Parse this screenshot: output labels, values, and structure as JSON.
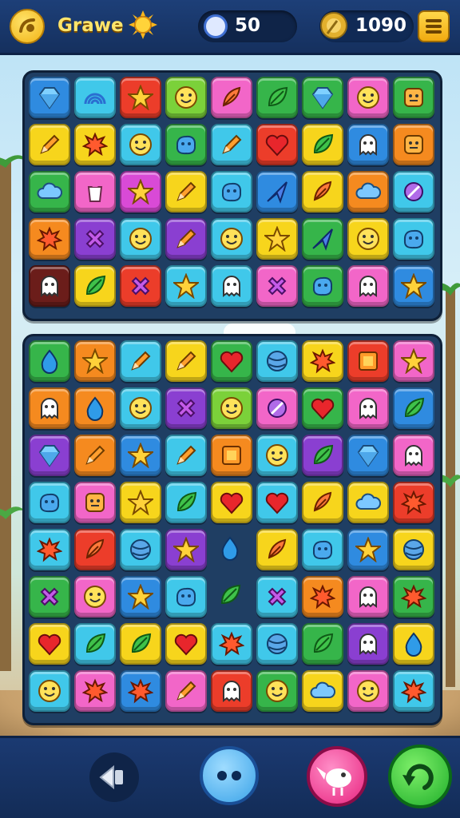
{
  "header": {
    "game_label": "Grawe",
    "moves_value": "50",
    "coins_value": "1090"
  },
  "colors": {
    "orange": "#f58a1f",
    "cyan": "#40c8ea",
    "red": "#ec3d2a",
    "lime": "#7bd13a",
    "pink": "#f266c8",
    "green": "#36b54a",
    "yellow": "#f7d51c",
    "purple": "#8a3fd1",
    "blue": "#2f8be0",
    "magenta": "#d94ad6",
    "teal": "#29b7c9",
    "maroon": "#6b1d1a"
  },
  "board_top": {
    "rows": [
      [
        [
          "blue",
          "gem-icon"
        ],
        [
          "cyan",
          "rainbow-icon"
        ],
        [
          "red",
          "star-icon"
        ],
        [
          "lime",
          "smile-icon"
        ],
        [
          "pink",
          "feather-icon"
        ],
        [
          "green",
          "leaf-icon"
        ],
        [
          "green",
          "gem-icon"
        ],
        [
          "pink",
          "smile-icon"
        ],
        [
          "green",
          "face-icon"
        ]
      ],
      [
        [
          "yellow",
          "pencil-icon"
        ],
        [
          "yellow",
          "splat-icon"
        ],
        [
          "cyan",
          "smile-icon"
        ],
        [
          "green",
          "blob-icon"
        ],
        [
          "cyan",
          "pencil-icon"
        ],
        [
          "red",
          "heart-icon"
        ],
        [
          "yellow",
          "leaf-icon"
        ],
        [
          "blue",
          "ghost-icon"
        ],
        [
          "orange",
          "face-icon"
        ]
      ],
      [
        [
          "green",
          "cloud-icon"
        ],
        [
          "pink",
          "cup-icon"
        ],
        [
          "magenta",
          "star-icon"
        ],
        [
          "yellow",
          "pencil-icon"
        ],
        [
          "cyan",
          "blob-icon"
        ],
        [
          "blue",
          "arrow-icon"
        ],
        [
          "yellow",
          "feather-icon"
        ],
        [
          "orange",
          "cloud-icon"
        ],
        [
          "cyan",
          "ribbon-icon"
        ]
      ],
      [
        [
          "orange",
          "splat-icon"
        ],
        [
          "purple",
          "cross-icon"
        ],
        [
          "cyan",
          "smile-icon"
        ],
        [
          "purple",
          "pencil-icon"
        ],
        [
          "cyan",
          "smile-icon"
        ],
        [
          "yellow",
          "star-icon"
        ],
        [
          "green",
          "arrow-icon"
        ],
        [
          "yellow",
          "smile-icon"
        ],
        [
          "cyan",
          "blob-icon"
        ]
      ],
      [
        [
          "maroon",
          "ghost-icon"
        ],
        [
          "yellow",
          "leaf-icon"
        ],
        [
          "red",
          "cross-icon"
        ],
        [
          "cyan",
          "star-icon"
        ],
        [
          "cyan",
          "ghost-icon"
        ],
        [
          "pink",
          "cross-icon"
        ],
        [
          "green",
          "blob-icon"
        ],
        [
          "pink",
          "ghost-icon"
        ],
        [
          "blue",
          "star-icon"
        ]
      ]
    ]
  },
  "board_bottom": {
    "rows": [
      [
        [
          "green",
          "drop-icon"
        ],
        [
          "orange",
          "star-icon"
        ],
        [
          "cyan",
          "pencil-icon"
        ],
        [
          "yellow",
          "pencil-icon"
        ],
        [
          "green",
          "heart-icon"
        ],
        [
          "cyan",
          "ball-icon"
        ],
        [
          "yellow",
          "splat-icon"
        ],
        [
          "red",
          "box-icon"
        ],
        [
          "pink",
          "star-icon"
        ]
      ],
      [
        [
          "orange",
          "ghost-icon"
        ],
        [
          "orange",
          "drop-icon"
        ],
        [
          "cyan",
          "smile-icon"
        ],
        [
          "purple",
          "cross-icon"
        ],
        [
          "lime",
          "smile-icon"
        ],
        [
          "pink",
          "ribbon-icon"
        ],
        [
          "green",
          "heart-icon"
        ],
        [
          "pink",
          "ghost-icon"
        ],
        [
          "blue",
          "leaf-icon"
        ]
      ],
      [
        [
          "purple",
          "gem-icon"
        ],
        [
          "orange",
          "pencil-icon"
        ],
        [
          "blue",
          "star-icon"
        ],
        [
          "cyan",
          "pencil-icon"
        ],
        [
          "orange",
          "box-icon"
        ],
        [
          "cyan",
          "smile-icon"
        ],
        [
          "purple",
          "leaf-icon"
        ],
        [
          "blue",
          "gem-icon"
        ],
        [
          "pink",
          "ghost-icon"
        ]
      ],
      [
        [
          "cyan",
          "blob-icon"
        ],
        [
          "pink",
          "face-icon"
        ],
        [
          "yellow",
          "star-icon"
        ],
        [
          "cyan",
          "leaf-icon"
        ],
        [
          "yellow",
          "heart-icon"
        ],
        [
          "cyan",
          "heart-icon"
        ],
        [
          "yellow",
          "feather-icon"
        ],
        [
          "yellow",
          "cloud-icon"
        ],
        [
          "red",
          "splat-icon"
        ]
      ],
      [
        [
          "cyan",
          "splat-icon"
        ],
        [
          "red",
          "feather-icon"
        ],
        [
          "cyan",
          "ball-icon"
        ],
        [
          "purple",
          "star-icon"
        ],
        [
          "empty",
          "drop-icon"
        ],
        [
          "yellow",
          "feather-icon"
        ],
        [
          "cyan",
          "blob-icon"
        ],
        [
          "blue",
          "star-icon"
        ],
        [
          "yellow",
          "ball-icon"
        ]
      ],
      [
        [
          "green",
          "cross-icon"
        ],
        [
          "pink",
          "smile-icon"
        ],
        [
          "blue",
          "star-icon"
        ],
        [
          "cyan",
          "blob-icon"
        ],
        [
          "empty",
          "leaf-icon"
        ],
        [
          "cyan",
          "cross-icon"
        ],
        [
          "orange",
          "splat-icon"
        ],
        [
          "pink",
          "ghost-icon"
        ],
        [
          "green",
          "splat-icon"
        ]
      ],
      [
        [
          "yellow",
          "heart-icon"
        ],
        [
          "cyan",
          "leaf-icon"
        ],
        [
          "yellow",
          "leaf-icon"
        ],
        [
          "yellow",
          "heart-icon"
        ],
        [
          "cyan",
          "splat-icon"
        ],
        [
          "cyan",
          "ball-icon"
        ],
        [
          "green",
          "leaf-icon"
        ],
        [
          "purple",
          "ghost-icon"
        ],
        [
          "yellow",
          "drop-icon"
        ]
      ],
      [
        [
          "cyan",
          "smile-icon"
        ],
        [
          "pink",
          "splat-icon"
        ],
        [
          "blue",
          "splat-icon"
        ],
        [
          "pink",
          "pencil-icon"
        ],
        [
          "red",
          "ghost-icon"
        ],
        [
          "green",
          "smile-icon"
        ],
        [
          "yellow",
          "cloud-icon"
        ],
        [
          "pink",
          "smile-icon"
        ],
        [
          "cyan",
          "splat-icon"
        ]
      ]
    ]
  },
  "footer": {
    "buttons": [
      "sound-icon",
      "menu-icon",
      "bird-icon",
      "refresh-icon"
    ]
  }
}
